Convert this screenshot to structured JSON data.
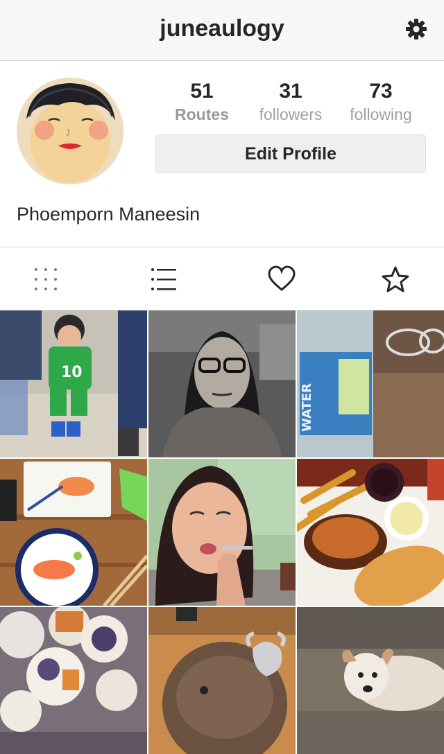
{
  "header": {
    "username": "juneaulogy",
    "settings_icon": "gear-icon"
  },
  "profile": {
    "full_name": "Phoemporn Maneesin",
    "stats": [
      {
        "value": "51",
        "label": "Routes"
      },
      {
        "value": "31",
        "label": "followers"
      },
      {
        "value": "73",
        "label": "following"
      }
    ],
    "edit_button_label": "Edit Profile"
  },
  "tabs": [
    {
      "icon": "grid-view-icon"
    },
    {
      "icon": "list-view-icon"
    },
    {
      "icon": "heart-icon"
    },
    {
      "icon": "star-icon"
    }
  ],
  "grid": {
    "photos": [
      "toddler-in-green-jersey",
      "woman-with-glasses-bw",
      "water-bottle-and-glasses",
      "salmon-sashimi-plates",
      "woman-eating-selfie",
      "fries-and-fried-food",
      "table-of-dishes",
      "stuffed-animal-toy",
      "small-white-dog"
    ]
  }
}
